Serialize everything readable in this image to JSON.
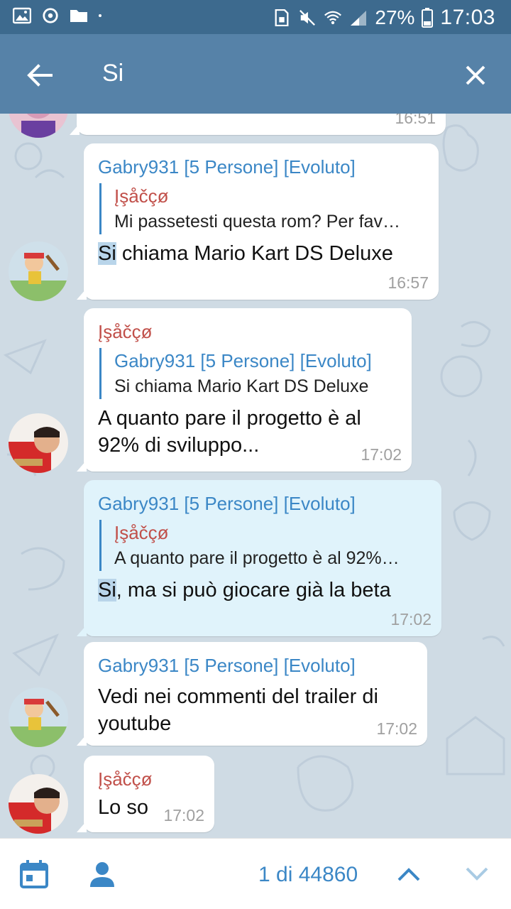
{
  "statusbar": {
    "battery": "27%",
    "time": "17:03",
    "icons": [
      "image-icon",
      "sync-icon",
      "folder-icon",
      "dot-icon",
      "sim-icon",
      "mute-icon",
      "wifi-icon",
      "signal-icon",
      "battery-icon"
    ]
  },
  "actionbar": {
    "query": "Si",
    "back_icon": "arrow-left-icon",
    "close_icon": "close-icon"
  },
  "messages": [
    {
      "sender": "",
      "time": "16:51"
    },
    {
      "sender": "Gabry931 [5 Persone] [Evoluto]",
      "reply_name": "Įşåčçø",
      "reply_text": "Mi passetesti questa rom? Per fav…",
      "text_match": "Si",
      "text_rest": " chiama Mario Kart DS Deluxe",
      "time": "16:57"
    },
    {
      "sender": "Įşåčçø",
      "reply_name": "Gabry931 [5 Persone] [Evoluto]",
      "reply_text": "Si chiama Mario Kart DS Deluxe",
      "text": "A quanto pare il progetto  è al 92% di sviluppo...",
      "time": "17:02"
    },
    {
      "sender": "Gabry931 [5 Persone] [Evoluto]",
      "reply_name": "Įşåčçø",
      "reply_text": "A quanto pare il progetto  è al 92%…",
      "text_match": "Si",
      "text_rest": ", ma si può giocare già la beta",
      "time": "17:02"
    },
    {
      "sender": "Gabry931 [5 Persone] [Evoluto]",
      "text": "Vedi nei commenti del trailer di youtube",
      "time": "17:02"
    },
    {
      "sender": "Įşåčçø",
      "text": "Lo so",
      "time": "17:02"
    }
  ],
  "bottombar": {
    "counter": "1 di 44860",
    "icons": [
      "calendar-icon",
      "user-icon",
      "chevron-up-icon",
      "chevron-down-icon"
    ]
  },
  "colors": {
    "statusbar": "#3d6a8e",
    "actionbar": "#5682a8",
    "chat_bg": "#cfdbe4",
    "sender_blue": "#3b87c6",
    "sender_red": "#c1504a",
    "highlight_bubble": "#e0f3fb"
  }
}
